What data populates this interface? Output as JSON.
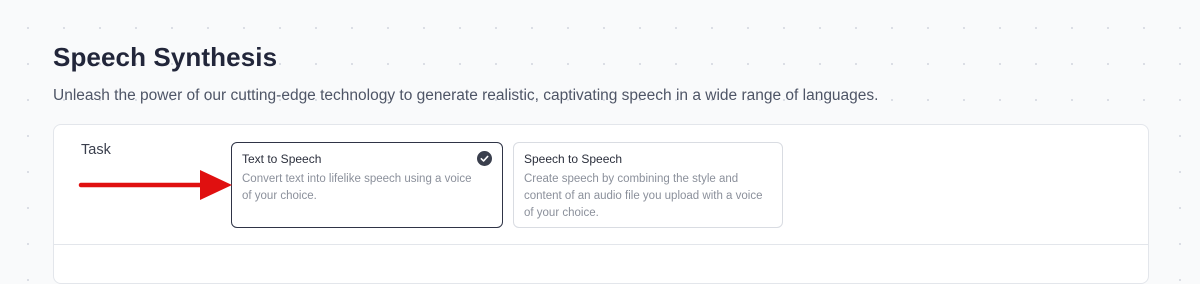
{
  "header": {
    "title": "Speech Synthesis",
    "subtitle": "Unleash the power of our cutting-edge technology to generate realistic, captivating speech in a wide range of languages."
  },
  "task": {
    "label": "Task",
    "options": [
      {
        "title": "Text to Speech",
        "description": "Convert text into lifelike speech using a voice of your choice.",
        "selected": true
      },
      {
        "title": "Speech to Speech",
        "description": "Create speech by combining the style and content of an audio file you upload with a voice of your choice.",
        "selected": false
      }
    ]
  },
  "icons": {
    "selected_indicator": "check-circle-icon",
    "annotation": "arrow-right-icon"
  },
  "colors": {
    "background": "#f9fafb",
    "title": "#22263a",
    "selected_border": "#2f3446",
    "check_fill": "#3a3f4d",
    "annotation_arrow": "#e01010"
  }
}
